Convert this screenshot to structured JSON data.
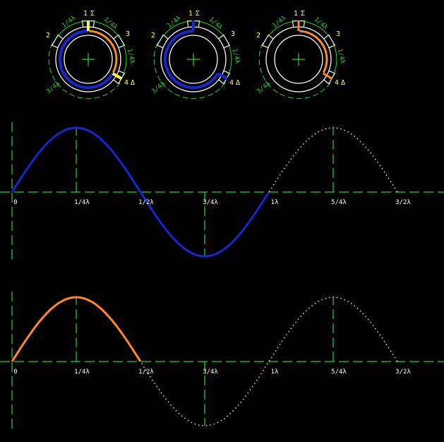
{
  "colors": {
    "background": "#000000",
    "axis": "#2bd52b",
    "label": "#ffffff",
    "port_label": "#ffff66",
    "wave_blue": "#1428d0",
    "wave_orange": "#ff8a26",
    "stub_yellow": "#ffff33",
    "outline": "#ffffff"
  },
  "rings": [
    {
      "ports": {
        "p1": "1",
        "sigma": "Σ",
        "p2": "2",
        "p3": "3",
        "p4": "4",
        "delta": "Δ"
      },
      "arcs": {
        "a12": "1/4λ",
        "a13": "1/4λ",
        "a34": "1/4λ",
        "a24": "3/4λ"
      },
      "paths": [
        "blue",
        "orange"
      ]
    },
    {
      "ports": {
        "p1": "1",
        "sigma": "Σ",
        "p2": "2",
        "p3": "3",
        "p4": "4",
        "delta": "Δ"
      },
      "arcs": {
        "a12": "1/4λ",
        "a13": "1/4λ",
        "a34": "1/4λ",
        "a24": "3/4λ"
      },
      "paths": [
        "blue"
      ]
    },
    {
      "ports": {
        "p1": "1",
        "sigma": "Σ",
        "p2": "2",
        "p3": "3",
        "p4": "4",
        "delta": "Δ"
      },
      "arcs": {
        "a12": "1/4λ",
        "a13": "1/4λ",
        "a34": "1/4λ",
        "a24": "3/4λ"
      },
      "paths": [
        "orange"
      ]
    }
  ],
  "plots": [
    {
      "ticks": [
        "0",
        "1/4λ",
        "1/2λ",
        "3/4λ",
        "1λ",
        "5/4λ",
        "3/2λ"
      ],
      "solid_range_lambda": [
        0,
        1
      ],
      "solid_color": "blue"
    },
    {
      "ticks": [
        "0",
        "1/4λ",
        "1/2λ",
        "3/4λ",
        "1λ",
        "5/4λ",
        "3/2λ"
      ],
      "solid_range_lambda": [
        0,
        0.5
      ],
      "solid_color": "orange"
    }
  ]
}
